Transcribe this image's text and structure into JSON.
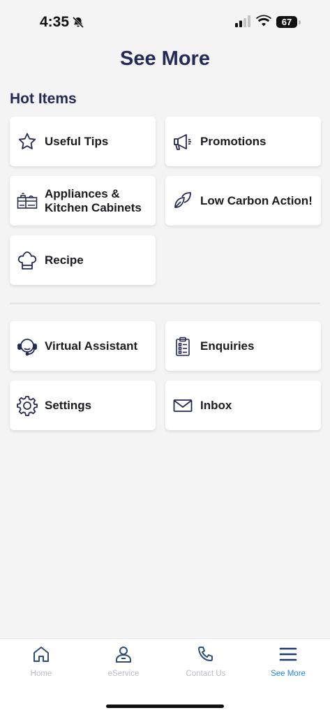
{
  "status_bar": {
    "time": "4:35",
    "battery": "67"
  },
  "header": {
    "title": "See More"
  },
  "hot_items": {
    "title": "Hot Items",
    "items": [
      {
        "label": "Useful Tips",
        "icon": "star-icon"
      },
      {
        "label": "Promotions",
        "icon": "megaphone-icon"
      },
      {
        "label": "Appliances & Kitchen Cabinets",
        "icon": "kitchen-icon"
      },
      {
        "label": "Low Carbon Action!",
        "icon": "leaf-icon"
      },
      {
        "label": "Recipe",
        "icon": "chef-hat-icon"
      }
    ]
  },
  "other_items": [
    {
      "label": "Virtual Assistant",
      "icon": "headset-icon"
    },
    {
      "label": "Enquiries",
      "icon": "clipboard-icon"
    },
    {
      "label": "Settings",
      "icon": "gear-icon"
    },
    {
      "label": "Inbox",
      "icon": "envelope-icon"
    }
  ],
  "bottom_nav": {
    "items": [
      {
        "label": "Home",
        "icon": "home-icon",
        "active": false
      },
      {
        "label": "eService",
        "icon": "user-icon",
        "active": false
      },
      {
        "label": "Contact Us",
        "icon": "phone-icon",
        "active": false
      },
      {
        "label": "See More",
        "icon": "menu-icon",
        "active": true
      }
    ]
  },
  "colors": {
    "title": "#232a55",
    "icon": "#232a55",
    "active_nav": "#1e88e5",
    "inactive_nav": "#b9bcc4",
    "background": "#f4f4f5"
  }
}
